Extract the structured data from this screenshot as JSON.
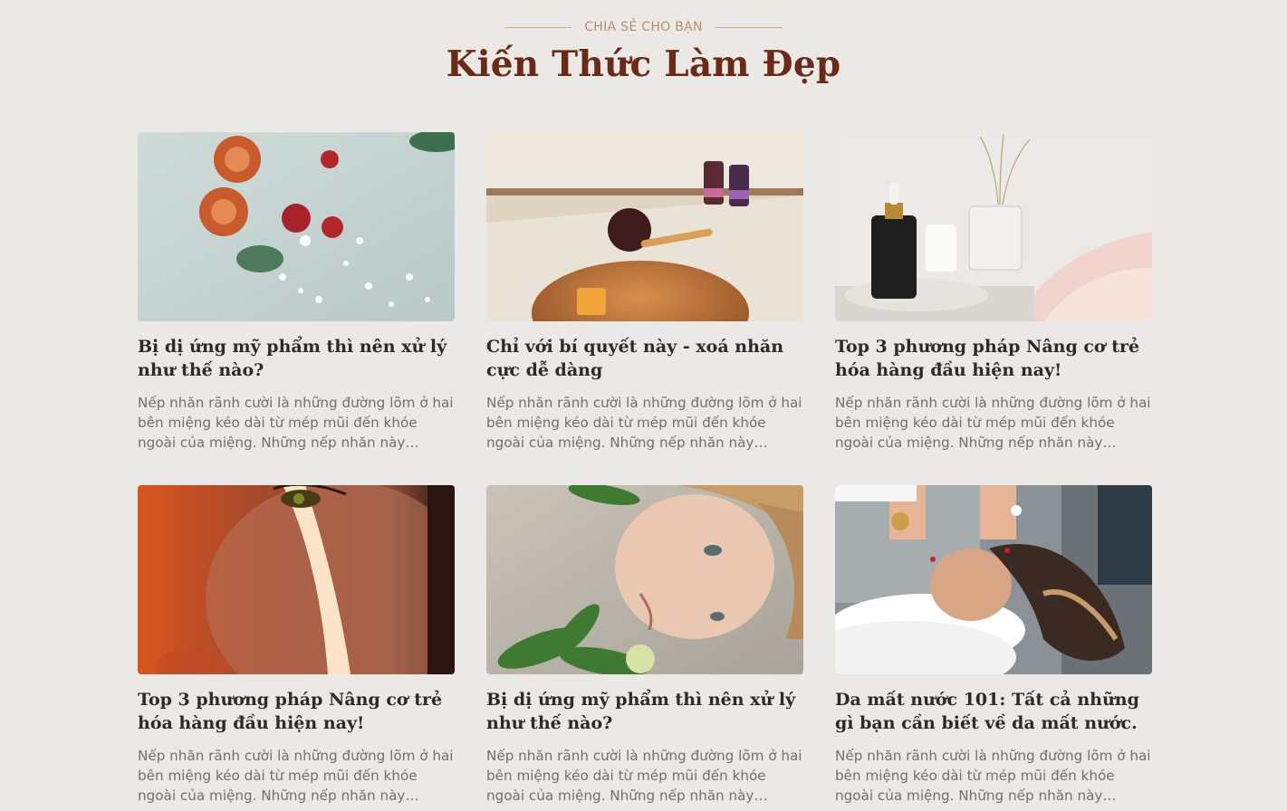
{
  "header": {
    "eyebrow": "CHIA SẺ CHO BẠN",
    "title": "Kiến Thức Làm Đẹp"
  },
  "posts": [
    {
      "image": "flowers-on-water-photo",
      "title": "Bị dị ứng mỹ phẩm thì nên xử lý như thế nào?",
      "excerpt": "Nếp nhăn rãnh cười là những đường lõm ở hai bên miệng kéo dài từ mép mũi đến khóe ngoài của miệng. Những nếp nhăn này thường sẽ hiện rõ hơn khi bạn cười."
    },
    {
      "image": "aromatherapy-bowl-photo",
      "title": "Chỉ với bí quyết này - xoá nhăn cực dễ dàng",
      "excerpt": "Nếp nhăn rãnh cười là những đường lõm ở hai bên miệng kéo dài từ mép mũi đến khóe ngoài của miệng. Những nếp nhăn này thường sẽ hiện rõ hơn khi bạn cười."
    },
    {
      "image": "serum-bottle-photo",
      "title": "Top 3 phương pháp Nâng cơ trẻ hóa hàng đầu hiện nay!",
      "excerpt": "Nếp nhăn rãnh cười là những đường lõm ở hai bên miệng kéo dài từ mép mũi đến khóe ngoài của miệng. Những nếp nhăn này thường sẽ hiện rõ hơn khi bạn cười."
    },
    {
      "image": "face-light-portrait-photo",
      "title": "Top 3 phương pháp Nâng cơ trẻ hóa hàng đầu hiện nay!",
      "excerpt": "Nếp nhăn rãnh cười là những đường lõm ở hai bên miệng kéo dài từ mép mũi đến khóe ngoài của miệng. Những nếp nhăn này thường sẽ hiện rõ hơn khi bạn cười."
    },
    {
      "image": "woman-with-leaves-photo",
      "title": "Bị dị ứng mỹ phẩm thì nên xử lý như thế nào?",
      "excerpt": "Nếp nhăn rãnh cười là những đường lõm ở hai bên miệng kéo dài từ mép mũi đến khóe ngoài của miệng. Những nếp nhăn này thường sẽ hiện rõ hơn khi bạn cười."
    },
    {
      "image": "facial-massage-photo",
      "title": "Da mất nước 101: Tất cả những gì bạn cần biết về da mất nước.",
      "excerpt": "Nếp nhăn rãnh cười là những đường lõm ở hai bên miệng kéo dài từ mép mũi đến khóe ngoài của miệng. Những nếp nhăn này thường sẽ hiện rõ hơn khi bạn cười."
    }
  ]
}
